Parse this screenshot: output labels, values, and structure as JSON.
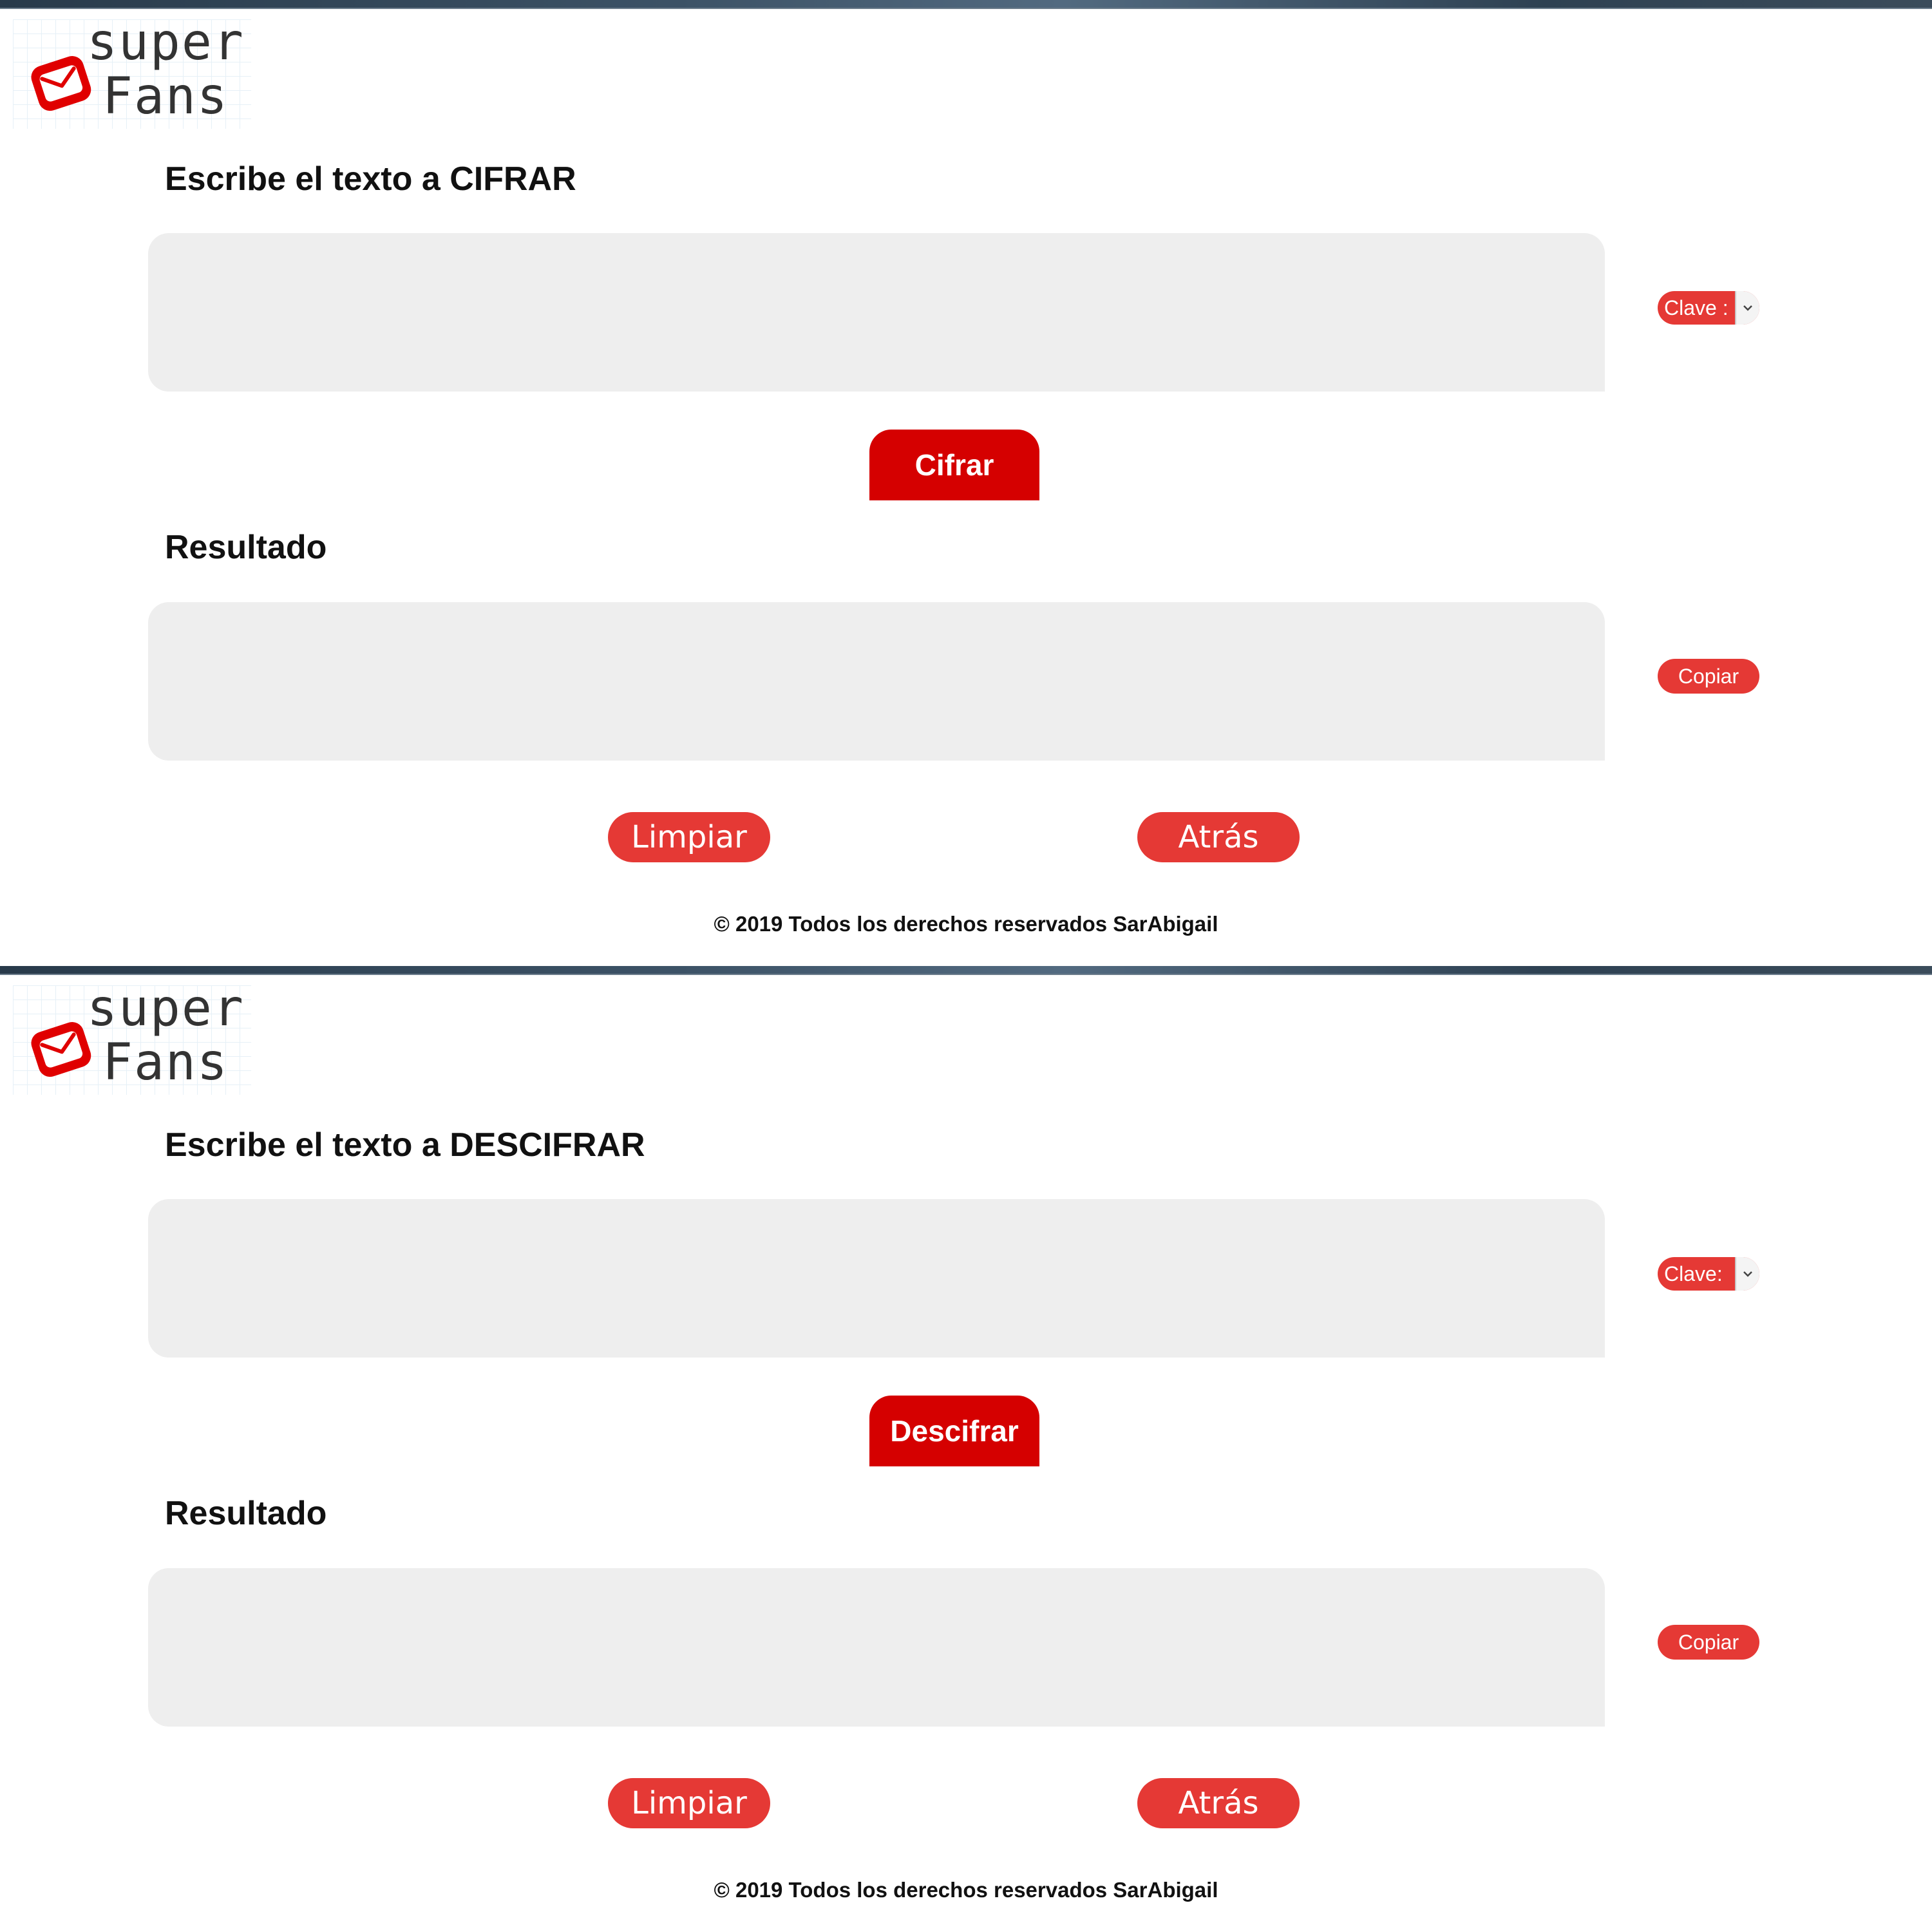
{
  "screens": [
    {
      "logo": {
        "line1": "super",
        "line2": "Fans"
      },
      "input_heading": "Escribe el texto a CIFRAR",
      "input_placeholder": "",
      "key_select_label": "Clave :",
      "action_button": "Cifrar",
      "result_heading": "Resultado",
      "result_placeholder": "",
      "copy_button": "Copiar",
      "clear_button": "Limpiar",
      "back_button": "Atrás",
      "footer": "© 2019 Todos los derechos reservados SarAbigail"
    },
    {
      "logo": {
        "line1": "super",
        "line2": "Fans"
      },
      "input_heading": "Escribe el texto a DESCIFRAR",
      "input_placeholder": "",
      "key_select_label": "Clave:",
      "action_button": "Descifrar",
      "result_heading": "Resultado",
      "result_placeholder": "",
      "copy_button": "Copiar",
      "clear_button": "Limpiar",
      "back_button": "Atrás",
      "footer": "© 2019 Todos los derechos reservados SarAbigail"
    }
  ],
  "colors": {
    "brand_red": "#d50000",
    "button_red": "#e53935",
    "textbox_bg": "#eeeeee",
    "heading_text": "#111111"
  },
  "icons": {
    "logo_mark": "envelope-icon",
    "select_arrow": "chevron-down-icon"
  }
}
